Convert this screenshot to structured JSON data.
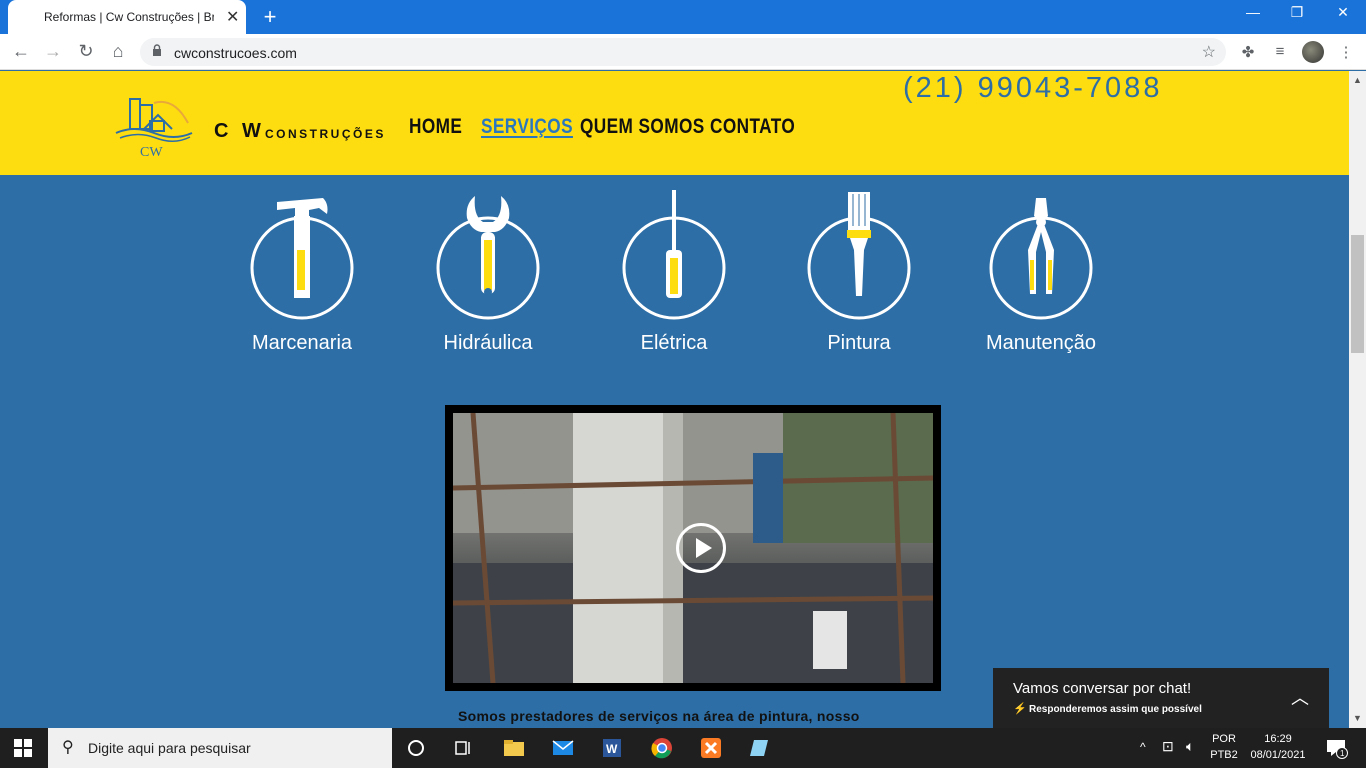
{
  "browser": {
    "tab_title": "Reformas | Cw Construções | Bras",
    "url": "cwconstrucoes.com"
  },
  "site": {
    "logo_text": "CW",
    "brand": "C W",
    "brand_sub": "CONSTRUÇÕES",
    "phone": "(21) 99043-7088",
    "nav": [
      "HOME",
      "SERVIÇOS",
      "QUEM SOMOS",
      "CONTATO"
    ],
    "active_nav": "SERVIÇOS",
    "colors": {
      "header": "#fedd10",
      "body": "#2d6ea6",
      "accent": "#2a77c0"
    }
  },
  "services": [
    {
      "label": "Marcenaria",
      "icon": "hammer-icon"
    },
    {
      "label": "Hidráulica",
      "icon": "wrench-icon"
    },
    {
      "label": "Elétrica",
      "icon": "screwdriver-icon"
    },
    {
      "label": "Pintura",
      "icon": "paintbrush-icon"
    },
    {
      "label": "Manutenção",
      "icon": "pliers-icon"
    }
  ],
  "description": "Somos prestadores de serviços na área de pintura, nosso",
  "chat": {
    "title": "Vamos conversar por chat!",
    "subtitle": "Responderemos assim que possível"
  },
  "taskbar": {
    "search_placeholder": "Digite aqui para pesquisar",
    "lang": "POR",
    "layout": "PTB2",
    "time": "16:29",
    "date": "08/01/2021",
    "notifications": "1"
  }
}
